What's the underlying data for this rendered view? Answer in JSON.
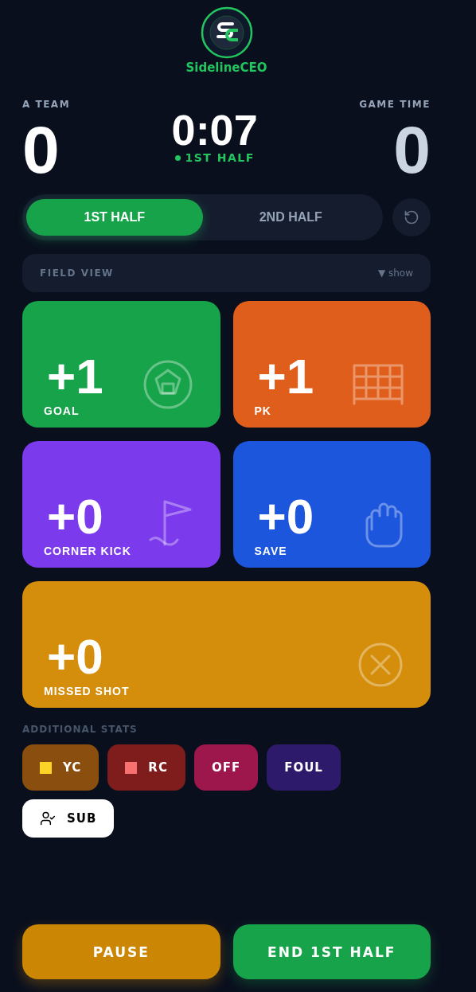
{
  "brand": {
    "name": "SidelineCEO"
  },
  "score": {
    "home_label": "A TEAM",
    "home_score": "0",
    "clock": "0:07",
    "period": "1ST HALF",
    "away_label": "GAME TIME",
    "away_score": "0"
  },
  "half_tabs": [
    {
      "label": "1ST HALF",
      "selected": true
    },
    {
      "label": "2ND HALF",
      "selected": false
    }
  ],
  "field_view": {
    "title": "FIELD VIEW",
    "toggle": "▼ show"
  },
  "stat_cards": [
    {
      "kind": "goal",
      "count": "+1",
      "label": "GOAL",
      "color": "#17a34a"
    },
    {
      "kind": "pk",
      "count": "+1",
      "label": "PK",
      "color": "#e05e1b"
    },
    {
      "kind": "corner",
      "count": "+0",
      "label": "CORNER KICK",
      "color": "#7c3aed"
    },
    {
      "kind": "save",
      "count": "+0",
      "label": "SAVE",
      "color": "#1c56dc"
    },
    {
      "kind": "miss",
      "count": "+0",
      "label": "MISSED SHOT",
      "color": "#d48e0b"
    }
  ],
  "additional_stats": {
    "title": "ADDITIONAL STATS",
    "chips": [
      {
        "kind": "card",
        "label": "YC",
        "color": "#8a4f0f",
        "marker": {
          "color": "#fcd327"
        }
      },
      {
        "kind": "card",
        "label": "RC",
        "color": "#7f1d1d",
        "marker": {
          "color": "#f87171"
        }
      },
      {
        "kind": "plain",
        "label": "OFF",
        "color": "#9d174d"
      },
      {
        "kind": "plain",
        "label": "FOUL",
        "color": "#2e1a6b"
      },
      {
        "kind": "sub",
        "label": "SUB",
        "color": "#ffffff"
      }
    ]
  },
  "actions": [
    {
      "kind": "pause",
      "label": "PAUSE"
    },
    {
      "kind": "end",
      "label": "END 1ST HALF"
    }
  ]
}
